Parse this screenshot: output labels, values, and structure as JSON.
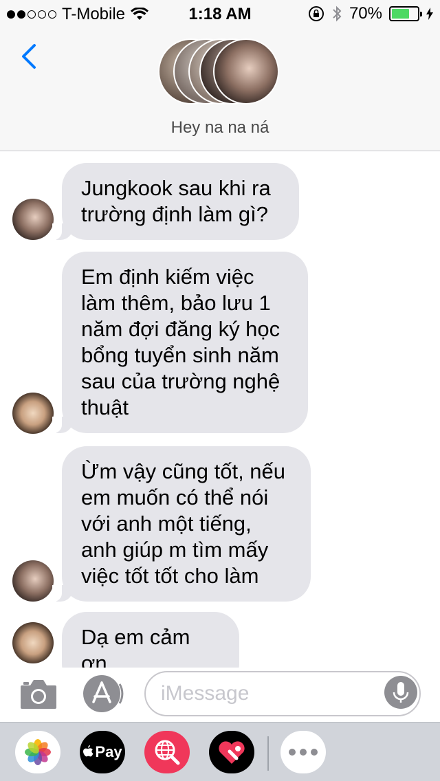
{
  "status_bar": {
    "carrier": "T-Mobile",
    "time": "1:18 AM",
    "battery": "70%",
    "battery_level": 0.7
  },
  "header": {
    "group_name": "Hey na na ná",
    "back_icon": "chevron-left-icon"
  },
  "messages": [
    {
      "text": "Jungkook sau khi ra trường định làm gì?"
    },
    {
      "text": "Em định kiếm việc làm thêm, bảo lưu 1 năm đợi đăng ký học bổng tuyển sinh năm sau của trường nghệ thuật"
    },
    {
      "text": "Ừm vậy cũng tốt, nếu em muốn có thể nói với anh một tiếng, anh giúp m tìm mấy việc tốt tốt cho làm"
    },
    {
      "text": "Dạ em cảm ơn"
    }
  ],
  "input": {
    "placeholder": "iMessage"
  },
  "app_drawer": {
    "apple_pay_label": "Pay"
  },
  "colors": {
    "accent": "#007aff",
    "bubble_gray": "#e5e5ea",
    "battery_green": "#4cd964",
    "drawer_bg": "#d1d4da"
  }
}
